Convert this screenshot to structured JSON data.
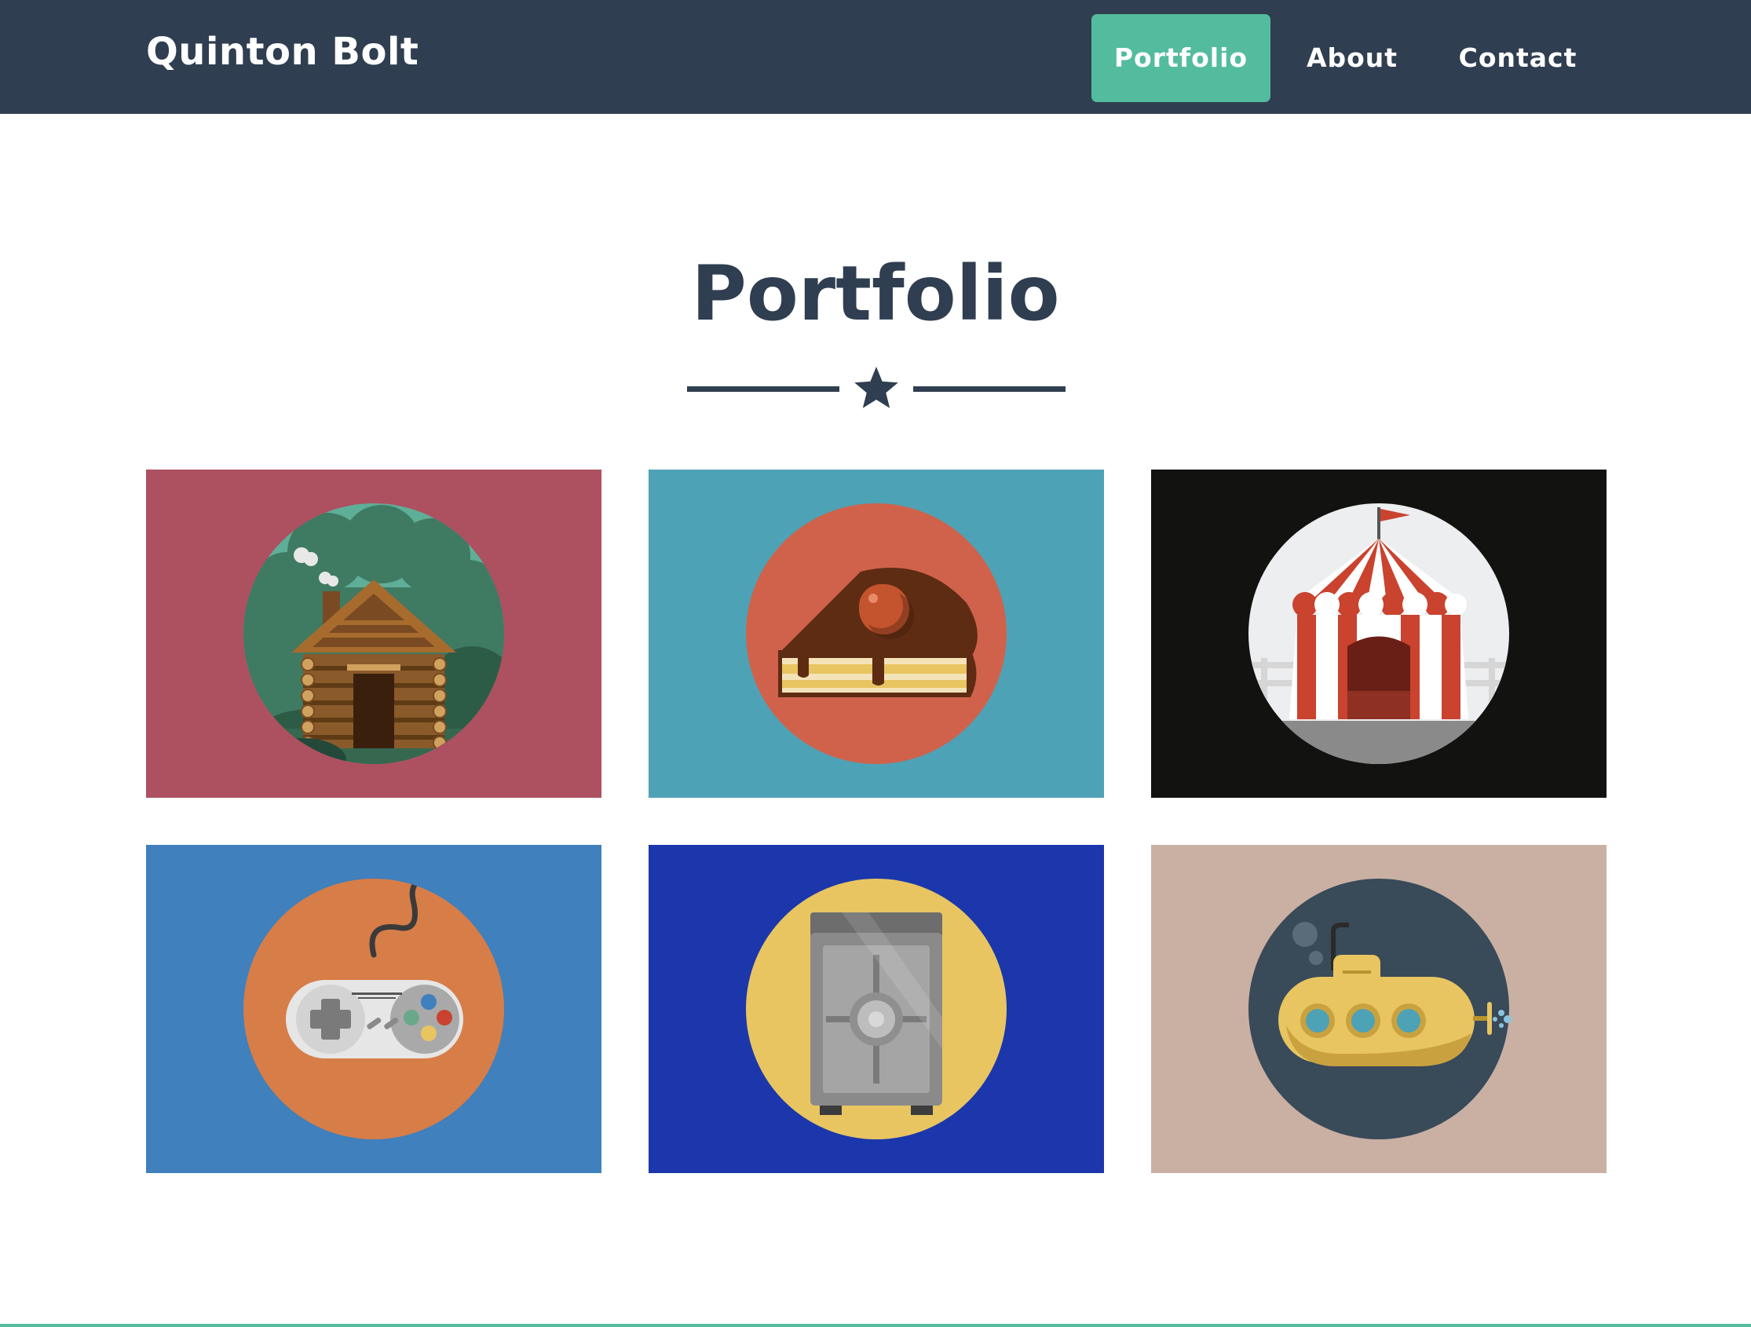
{
  "navbar": {
    "brand": "Quinton Bolt",
    "links": [
      {
        "label": "Portfolio",
        "active": true
      },
      {
        "label": "About",
        "active": false
      },
      {
        "label": "Contact",
        "active": false
      }
    ],
    "background": "#2f3e50",
    "active_color": "#54bc9e"
  },
  "section": {
    "title": "Portfolio",
    "divider_icon": "star-icon",
    "title_color": "#2f3e50"
  },
  "portfolio_items": [
    {
      "icon": "log-cabin-icon",
      "background": "#ad5060",
      "circle": "#5fae97"
    },
    {
      "icon": "cake-slice-icon",
      "background": "#4ea2b5",
      "circle": "#d0624b"
    },
    {
      "icon": "circus-tent-icon",
      "background": "#121210",
      "circle": "#eceeef"
    },
    {
      "icon": "game-controller-icon",
      "background": "#3f80bd",
      "circle": "#d77d48"
    },
    {
      "icon": "safe-icon",
      "background": "#1b37ab",
      "circle": "#e8c561"
    },
    {
      "icon": "submarine-icon",
      "background": "#c9b0a3",
      "circle": "#394a59"
    }
  ]
}
